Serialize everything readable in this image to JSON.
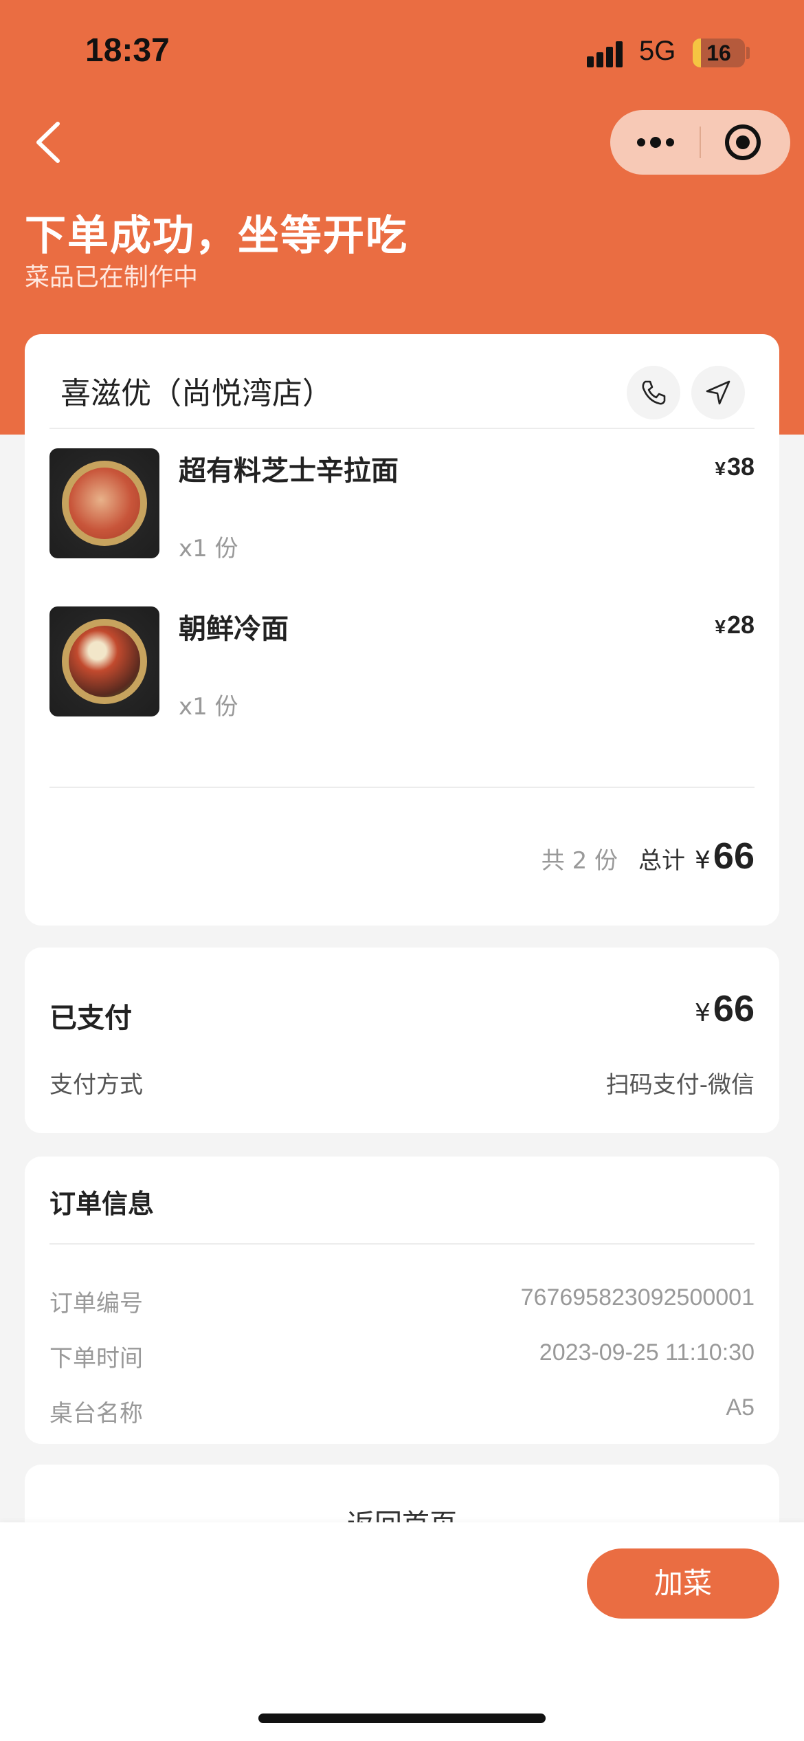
{
  "status_bar": {
    "time": "18:37",
    "network": "5G",
    "battery": "16"
  },
  "header": {
    "title": "下单成功，坐等开吃",
    "subtitle": "菜品已在制作中"
  },
  "order": {
    "shop_name": "喜滋优（尚悦湾店）",
    "items": [
      {
        "name": "超有料芝士辛拉面",
        "qty": "x1 份",
        "currency": "¥",
        "price": "38"
      },
      {
        "name": "朝鲜冷面",
        "qty": "x1 份",
        "currency": "¥",
        "price": "28"
      }
    ],
    "count_text": "共 2 份",
    "total_label": "总计",
    "total_currency": "¥",
    "total_value": "66"
  },
  "payment": {
    "status_label": "已支付",
    "currency": "¥",
    "amount": "66",
    "method_label": "支付方式",
    "method_value": "扫码支付-微信"
  },
  "order_info": {
    "title": "订单信息",
    "rows": [
      {
        "label": "订单编号",
        "value": "767695823092500001"
      },
      {
        "label": "下单时间",
        "value": "2023-09-25 11:10:30"
      },
      {
        "label": "桌台名称",
        "value": "A5"
      }
    ]
  },
  "actions": {
    "back_home": "返回首页",
    "add_dish": "加菜"
  },
  "colors": {
    "accent": "#ea6d42",
    "capsule": "#f7c9b6"
  },
  "icons": [
    "back-icon",
    "more-icon",
    "close-target-icon",
    "phone-icon",
    "navigate-icon"
  ]
}
